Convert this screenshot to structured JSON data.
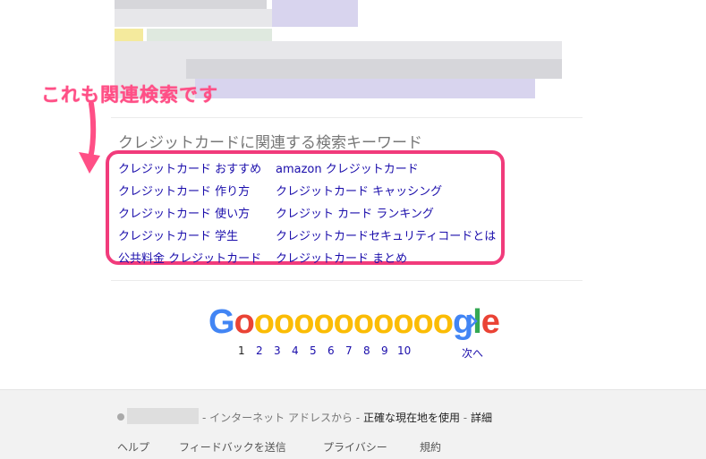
{
  "annotation": {
    "text": "これも関連検索です"
  },
  "related": {
    "title": "クレジットカードに関連する検索キーワード",
    "col1": [
      "クレジットカード おすすめ",
      "クレジットカード 作り方",
      "クレジットカード 使い方",
      "クレジットカード 学生",
      "公共料金 クレジットカード"
    ],
    "col2": [
      "amazon クレジットカード",
      "クレジットカード キャッシング",
      "クレジット カード ランキング",
      "クレジットカードセキュリティコードとは",
      "クレジットカード まとめ"
    ]
  },
  "pagination": {
    "logo_letters": [
      "G",
      "o",
      "o",
      "o",
      "o",
      "o",
      "o",
      "o",
      "o",
      "o",
      "o",
      "o",
      "g",
      "l",
      "e"
    ],
    "colors": {
      "blue": "#4285f4",
      "red": "#ea4335",
      "yellow": "#fbbc05",
      "green": "#34a853"
    },
    "pages": [
      "1",
      "2",
      "3",
      "4",
      "5",
      "6",
      "7",
      "8",
      "9",
      "10"
    ],
    "current_page": "1",
    "next_label": "次へ",
    "next_icon": "chevron-right-icon"
  },
  "footer": {
    "location_sep": " - ",
    "location_text": "インターネット アドレスから",
    "precise_link": "正確な現在地を使用",
    "details_link": "詳細",
    "links": [
      "ヘルプ",
      "フィードバックを送信",
      "プライバシー",
      "規約"
    ]
  }
}
